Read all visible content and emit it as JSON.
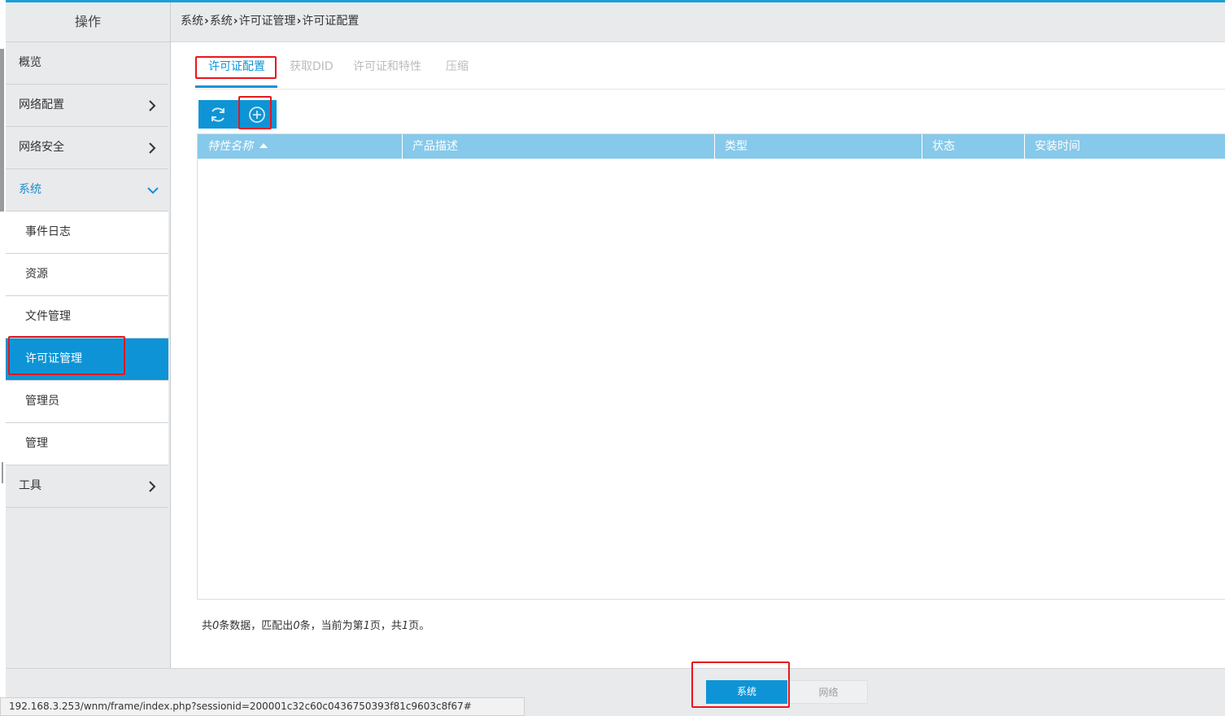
{
  "sidebar": {
    "header": "操作",
    "items": [
      {
        "label": "概览",
        "has_chevron": false
      },
      {
        "label": "网络配置",
        "has_chevron": true
      },
      {
        "label": "网络安全",
        "has_chevron": true
      },
      {
        "label": "系统",
        "has_chevron": true,
        "expanded": true
      },
      {
        "label": "工具",
        "has_chevron": true
      }
    ],
    "sub_items": [
      {
        "label": "事件日志"
      },
      {
        "label": "资源"
      },
      {
        "label": "文件管理"
      },
      {
        "label": "许可证管理",
        "selected": true
      },
      {
        "label": "管理员"
      },
      {
        "label": "管理"
      }
    ]
  },
  "breadcrumb": [
    "系统",
    "系统",
    "许可证管理",
    "许可证配置"
  ],
  "tabs": [
    {
      "label": "许可证配置",
      "active": true
    },
    {
      "label": "获取DID"
    },
    {
      "label": "许可证和特性"
    },
    {
      "label": "压缩"
    }
  ],
  "toolbar": {
    "refresh_icon": "refresh-icon",
    "add_icon": "plus-circle-icon"
  },
  "table": {
    "columns": [
      "特性名称",
      "产品描述",
      "类型",
      "状态",
      "安装时间"
    ],
    "rows": []
  },
  "pager": {
    "prefix": "共",
    "total": "0",
    "mid1": "条数据，匹配出",
    "matched": "0",
    "mid2": "条，当前为第",
    "page": "1",
    "mid3": "页，共",
    "pages": "1",
    "suffix": "页。"
  },
  "bottom_tabs": [
    {
      "label": "系统",
      "active": true
    },
    {
      "label": "网络"
    }
  ],
  "status_url": "192.168.3.253/wnm/frame/index.php?sessionid=200001c32c60c0436750393f81c9603c8f67#",
  "colors": {
    "accent": "#0e94d6",
    "table_header": "#86c9ea",
    "highlight": "#e8161b"
  }
}
